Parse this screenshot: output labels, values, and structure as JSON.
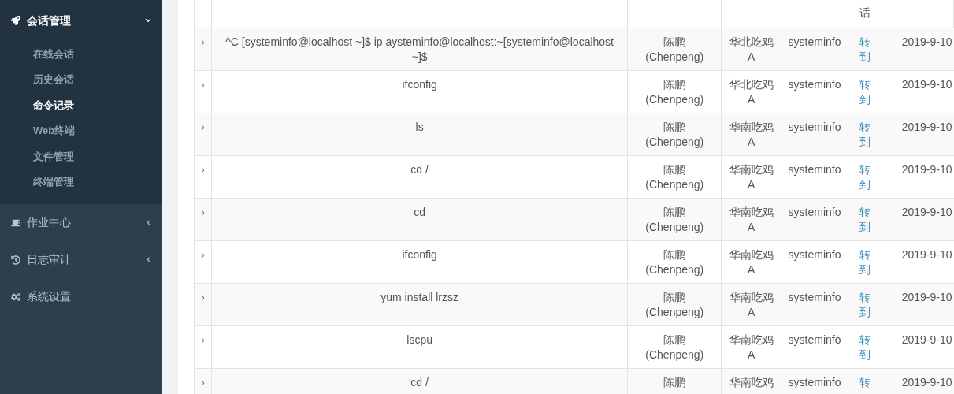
{
  "sidebar": {
    "groups": [
      {
        "label": "会话管理",
        "expanded": true,
        "items": [
          {
            "label": "在线会话",
            "selected": false
          },
          {
            "label": "历史会话",
            "selected": false
          },
          {
            "label": "命令记录",
            "selected": true
          },
          {
            "label": "Web终端",
            "selected": false
          },
          {
            "label": "文件管理",
            "selected": false
          },
          {
            "label": "终端管理",
            "selected": false
          }
        ]
      },
      {
        "label": "作业中心",
        "expanded": false
      },
      {
        "label": "日志审计",
        "expanded": false
      },
      {
        "label": "系统设置"
      }
    ]
  },
  "table": {
    "column_5": "话",
    "rows": [
      {
        "expand": "›",
        "command": "^C [systeminfo@localhost ~]$ ip aysteminfo@localhost:~[systeminfo@localhost ~]$",
        "user": [
          "陈鹏",
          "(Chenpeng)"
        ],
        "host": [
          "华北吃鸡",
          "A"
        ],
        "account": "systeminfo",
        "action": "转到",
        "date": "2019-9-10"
      },
      {
        "expand": "›",
        "command": "ifconfig",
        "user": [
          "陈鹏",
          "(Chenpeng)"
        ],
        "host": [
          "华北吃鸡",
          "A"
        ],
        "account": "systeminfo",
        "action": "转到",
        "date": "2019-9-10"
      },
      {
        "expand": "›",
        "command": "ls",
        "user": [
          "陈鹏",
          "(Chenpeng)"
        ],
        "host": [
          "华南吃鸡",
          "A"
        ],
        "account": "systeminfo",
        "action": "转到",
        "date": "2019-9-10"
      },
      {
        "expand": "›",
        "command": "cd /",
        "user": [
          "陈鹏",
          "(Chenpeng)"
        ],
        "host": [
          "华南吃鸡",
          "A"
        ],
        "account": "systeminfo",
        "action": "转到",
        "date": "2019-9-10"
      },
      {
        "expand": "›",
        "command": "cd",
        "user": [
          "陈鹏",
          "(Chenpeng)"
        ],
        "host": [
          "华南吃鸡",
          "A"
        ],
        "account": "systeminfo",
        "action": "转到",
        "date": "2019-9-10"
      },
      {
        "expand": "›",
        "command": "ifconfig",
        "user": [
          "陈鹏",
          "(Chenpeng)"
        ],
        "host": [
          "华南吃鸡",
          "A"
        ],
        "account": "systeminfo",
        "action": "转到",
        "date": "2019-9-10"
      },
      {
        "expand": "›",
        "command": "yum install lrzsz",
        "user": [
          "陈鹏",
          "(Chenpeng)"
        ],
        "host": [
          "华南吃鸡",
          "A"
        ],
        "account": "systeminfo",
        "action": "转到",
        "date": "2019-9-10"
      },
      {
        "expand": "›",
        "command": "lscpu",
        "user": [
          "陈鹏",
          "(Chenpeng)"
        ],
        "host": [
          "华南吃鸡",
          "A"
        ],
        "account": "systeminfo",
        "action": "转到",
        "date": "2019-9-10"
      },
      {
        "expand": "›",
        "command": "cd /",
        "user": [
          "陈鹏"
        ],
        "host": [
          "华南吃鸡"
        ],
        "account": "systeminfo",
        "action": "转",
        "date": "2019-9-10"
      }
    ]
  }
}
